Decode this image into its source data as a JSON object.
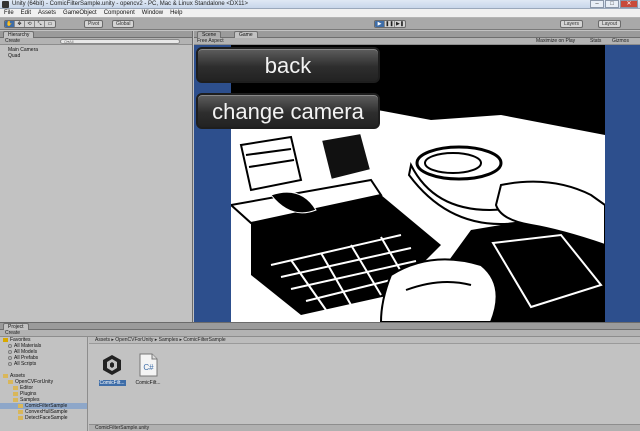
{
  "window": {
    "title": "Unity (64bit) - ComicFilterSample.unity - opencv2 - PC, Mac & Linux Standalone <DX11>",
    "buttons": [
      "–",
      "□",
      "✕"
    ]
  },
  "menu": [
    "File",
    "Edit",
    "Assets",
    "GameObject",
    "Component",
    "Window",
    "Help"
  ],
  "toolbar": {
    "tools": [
      "✋",
      "✥",
      "⟲",
      "⤡",
      "▭"
    ],
    "pivot": "Pivot",
    "global": "Global",
    "play": [
      "▶",
      "❚❚",
      "▶❚"
    ],
    "layers": "Layers",
    "layout": "Layout"
  },
  "hierarchy": {
    "tab": "Hierarchy",
    "create": "Create",
    "search_placeholder": "Q▾All",
    "items": [
      "Main Camera",
      "Quad"
    ]
  },
  "game": {
    "tabs": [
      "Scene",
      "Game"
    ],
    "aspect": "Free Aspect",
    "right_labels": [
      "Maximize on Play",
      "Stats",
      "Gizmos"
    ],
    "ui_buttons": {
      "back": "back",
      "change_camera": "change camera"
    }
  },
  "project": {
    "tab": "Project",
    "create": "Create",
    "breadcrumb": "Assets ▸ OpenCVForUnity ▸ Samples ▸ ComicFilterSample",
    "tree": [
      {
        "label": "Favorites",
        "indent": 0,
        "kind": "star"
      },
      {
        "label": "All Materials",
        "indent": 1,
        "kind": "search"
      },
      {
        "label": "All Models",
        "indent": 1,
        "kind": "search"
      },
      {
        "label": "All Prefabs",
        "indent": 1,
        "kind": "search"
      },
      {
        "label": "All Scripts",
        "indent": 1,
        "kind": "search"
      },
      {
        "label": "",
        "indent": 0,
        "kind": "blank"
      },
      {
        "label": "Assets",
        "indent": 0,
        "kind": "folder"
      },
      {
        "label": "OpenCVForUnity",
        "indent": 1,
        "kind": "folder"
      },
      {
        "label": "Editor",
        "indent": 2,
        "kind": "folder"
      },
      {
        "label": "Plugins",
        "indent": 2,
        "kind": "folder"
      },
      {
        "label": "Samples",
        "indent": 2,
        "kind": "folder"
      },
      {
        "label": "ComicFilterSample",
        "indent": 3,
        "kind": "folder",
        "selected": true
      },
      {
        "label": "ConvexHullSample",
        "indent": 3,
        "kind": "folder"
      },
      {
        "label": "DetectFaceSample",
        "indent": 3,
        "kind": "folder"
      }
    ],
    "assets": [
      {
        "label": "ComicFilt...",
        "icon": "unity-scene-icon",
        "selected": true
      },
      {
        "label": "ComicFilt...",
        "icon": "csharp-script-icon",
        "selected": false
      }
    ],
    "status": "ComicFilterSample.unity"
  },
  "colors": {
    "accent": "#3e6da8",
    "game_background": "#2d4f8d",
    "panel": "#c2c2c2"
  }
}
